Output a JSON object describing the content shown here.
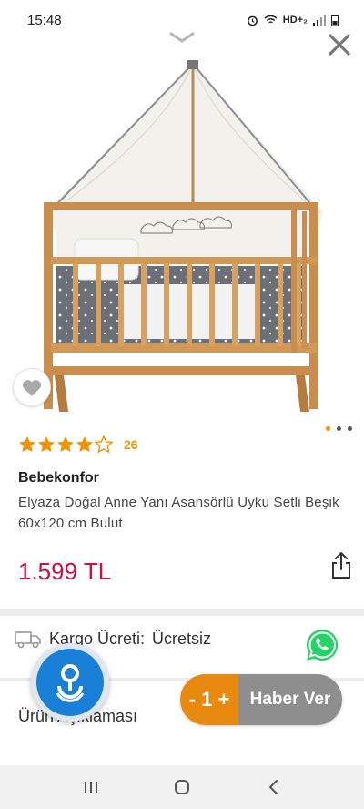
{
  "status": {
    "time": "15:48",
    "network": "HD+₂"
  },
  "product": {
    "rating_value": 4,
    "rating_count": "26",
    "brand": "Bebekonfor",
    "title": "Elyaza Doğal Anne Yanı Asansörlü Uyku Setli Beşik 60x120 cm Bulut",
    "price": "1.599 TL",
    "image_icon": "baby-crib-image",
    "gallery_active_index": 0,
    "gallery_count": 3
  },
  "shipping": {
    "label": "Kargo Ücreti:",
    "value": "Ücretsiz"
  },
  "description": {
    "label": "Ürün Açıklaması"
  },
  "review_pill": {
    "left_label": "- 1 +",
    "right_label": "Haber Ver"
  },
  "colors": {
    "accent": "#f39200",
    "price": "#d0103a",
    "whatsapp": "#25d366",
    "pill_orange": "#e88a0f",
    "pill_gray": "#8e8e8e"
  }
}
